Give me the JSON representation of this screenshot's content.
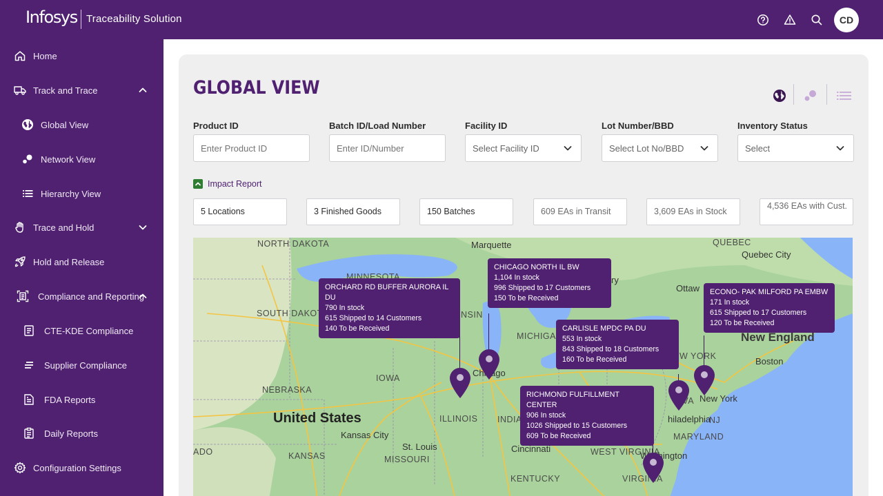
{
  "header": {
    "logo_text": "Infosys",
    "app_title": "Traceability Solution",
    "icons": [
      "help-circle-icon",
      "alert-triangle-icon",
      "search-icon"
    ],
    "avatar_initials": "CD",
    "brand_color": "#4f2170"
  },
  "sidebar": {
    "items": [
      {
        "label": "Home",
        "icon": "home-icon"
      },
      {
        "label": "Track and Trace",
        "icon": "truck-icon",
        "expanded": true
      },
      {
        "label": "Global View",
        "icon": "globe-icon"
      },
      {
        "label": "Network View",
        "icon": "network-icon"
      },
      {
        "label": "Hierarchy View",
        "icon": "list-icon"
      },
      {
        "label": "Trace and Hold",
        "icon": "hand-icon",
        "expanded": false
      },
      {
        "label": "Hold and Release",
        "icon": "rocket-icon"
      },
      {
        "label": "Compliance and Reporting",
        "icon": "compliance-icon",
        "expanded": true
      },
      {
        "label": "CTE-KDE Compliance",
        "icon": "document-icon"
      },
      {
        "label": "Supplier Compliance",
        "icon": "lines-icon"
      },
      {
        "label": "FDA Reports",
        "icon": "report-icon"
      },
      {
        "label": "Daily Reports",
        "icon": "clipboard-icon"
      },
      {
        "label": "Configuration Settings",
        "icon": "gear-icon"
      }
    ]
  },
  "page": {
    "title": "GLOBAL VIEW",
    "view_icons": [
      "globe-view-icon",
      "network-view-icon",
      "list-view-icon"
    ]
  },
  "filters": {
    "product_id": {
      "label": "Product ID",
      "placeholder": "Enter Product ID"
    },
    "batch_id": {
      "label": "Batch ID/Load Number",
      "placeholder": "Enter ID/Number"
    },
    "facility_id": {
      "label": "Facility ID",
      "value": "Select Facility ID"
    },
    "lot_number": {
      "label": "Lot Number/BBD",
      "value": "Select Lot No/BBD"
    },
    "inventory_status": {
      "label": "Inventory Status",
      "value": "Select"
    }
  },
  "impact_report": {
    "label": "Impact Report"
  },
  "stats": [
    "5 Locations",
    "3 Finished Goods",
    "150 Batches",
    "609 EAs in Transit",
    "3,609 EAs in Stock",
    "4,536 EAs with Cust."
  ],
  "map": {
    "labels": {
      "north_dakota": "NORTH DAKOTA",
      "south_dakota": "SOUTH DAKOTA",
      "minnesota": "MINNESOTA",
      "nebraska": "NEBRASKA",
      "iowa": "IOWA",
      "kansas": "KANSAS",
      "missouri": "MISSOURI",
      "illinois": "ILLINOIS",
      "indiana": "INDIA",
      "michigan": "MICHIGA",
      "west_virginia": "WEST VIRGINIA",
      "kentucky": "KENTUCKY",
      "virginia": "VIRGINIA",
      "maryland": "MARYLAND",
      "new_york_state": "W YORK",
      "new_jersey": "NJ",
      "pennsylvania": "YLVA",
      "colorado": "ADO",
      "quebec": "QUEBEC",
      "wisconsin": "NSIN",
      "united_states": "United States",
      "marquette": "Marquette",
      "chicago": "Chicago",
      "kansas_city": "Kansas City",
      "st_louis": "St. Louis",
      "cincinnati": "Cincinnati",
      "washington": "Washington",
      "philadelphia": "hiladelphia",
      "new_york": "New York",
      "boston": "Boston",
      "ottawa": "Ottaw",
      "quebec_city": "Quebec City",
      "new_england": "New England",
      "ry": "ry"
    },
    "locations": [
      {
        "name": "ORCHARD RD BUFFER AURORA IL DU",
        "in_stock": "790 In stock",
        "shipped": "615 Shipped to 14 Customers",
        "to_receive": "140 To be Received"
      },
      {
        "name": "CHICAGO NORTH IL BW",
        "in_stock": "1,104 In stock",
        "shipped": "996 Shipped to 17 Customers",
        "to_receive": "150 To be Received"
      },
      {
        "name": "CARLISLE MPDC PA DU",
        "in_stock": "553 In stock",
        "shipped": "843 Shipped to 18 Customers",
        "to_receive": "160 To be Received"
      },
      {
        "name": "ECONO- PAK MILFORD PA EMBW",
        "in_stock": "171 In stock",
        "shipped": "615 Shipped to 17 Customers",
        "to_receive": "120 To be Received"
      },
      {
        "name": "RICHMOND FULFILLMENT CENTER",
        "in_stock": "906 In stock",
        "shipped": "1026 Shipped to 15 Customers",
        "to_receive": "609 To be Received"
      }
    ]
  }
}
